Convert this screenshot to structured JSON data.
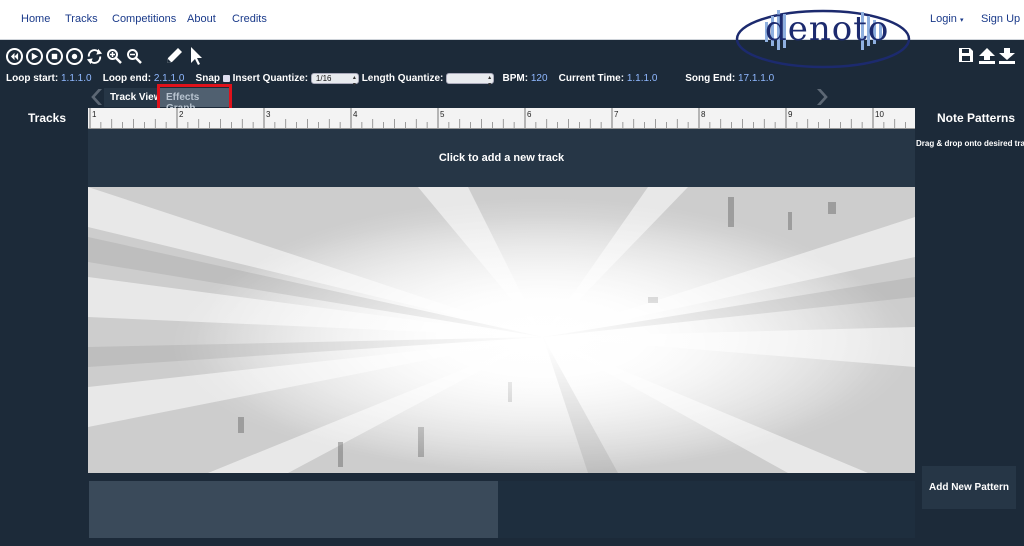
{
  "nav": {
    "links": [
      "Home",
      "Tracks",
      "Competitions",
      "About",
      "Credits"
    ],
    "login": "Login",
    "login_caret": "▾",
    "signup": "Sign Up",
    "logo_text": "denoto"
  },
  "toolbar": {
    "buttons": [
      "rewind-icon",
      "play-icon",
      "stop-icon",
      "record-icon",
      "loop-icon",
      "zoom-in-icon",
      "zoom-out-icon",
      "pencil-icon",
      "pointer-icon"
    ],
    "right_icons": [
      "save-icon",
      "upload-icon",
      "download-icon"
    ]
  },
  "settings": {
    "loop_start_label": "Loop start:",
    "loop_start_value": "1.1.1.0",
    "loop_end_label": "Loop end:",
    "loop_end_value": "2.1.1.0",
    "snap_label": "Snap",
    "insert_quantize_label": "Insert Quantize:",
    "insert_quantize_value": "1/16",
    "length_quantize_label": "Length Quantize:",
    "length_quantize_value": "",
    "bpm_label": "BPM:",
    "bpm_value": "120",
    "current_time_label": "Current Time:",
    "current_time_value": "1.1.1.0",
    "song_end_label": "Song End:",
    "song_end_value": "17.1.1.0"
  },
  "tabs": {
    "track_view": "Track View",
    "effects_graph": "Effects Graph"
  },
  "tracks_title": "Tracks",
  "ruler_numbers": [
    "1",
    "2",
    "3",
    "4",
    "5",
    "6",
    "7",
    "8",
    "9",
    "10"
  ],
  "add_track": "Click to add a new track",
  "note_patterns": {
    "title": "Note Patterns",
    "hint": "Drag & drop onto desired track",
    "add_button": "Add New Pattern"
  }
}
